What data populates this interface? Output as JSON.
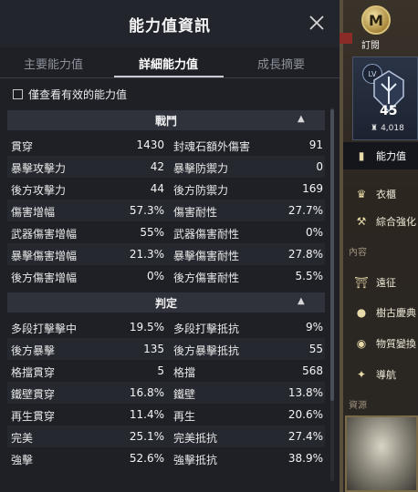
{
  "panel": {
    "title": "能力值資訊",
    "tabs": [
      {
        "label": "主要能力值",
        "active": false
      },
      {
        "label": "詳細能力值",
        "active": true
      },
      {
        "label": "成長摘要",
        "active": false
      }
    ],
    "filter_label": "僅查看有效的能力值",
    "sections": [
      {
        "title": "戰鬥",
        "rows": [
          {
            "left_label": "貫穿",
            "left_value": "1430",
            "right_label": "封魂石額外傷害",
            "right_value": "91"
          },
          {
            "left_label": "暴擊攻擊力",
            "left_value": "42",
            "right_label": "暴擊防禦力",
            "right_value": "0"
          },
          {
            "left_label": "後方攻擊力",
            "left_value": "44",
            "right_label": "後方防禦力",
            "right_value": "169"
          },
          {
            "left_label": "傷害增幅",
            "left_value": "57.3%",
            "right_label": "傷害耐性",
            "right_value": "27.7%"
          },
          {
            "left_label": "武器傷害增幅",
            "left_value": "55%",
            "right_label": "武器傷害耐性",
            "right_value": "0%"
          },
          {
            "left_label": "暴擊傷害增幅",
            "left_value": "21.3%",
            "right_label": "暴擊傷害耐性",
            "right_value": "27.8%"
          },
          {
            "left_label": "後方傷害增幅",
            "left_value": "0%",
            "right_label": "後方傷害耐性",
            "right_value": "5.5%"
          }
        ]
      },
      {
        "title": "判定",
        "rows": [
          {
            "left_label": "多段打擊擊中",
            "left_value": "19.5%",
            "right_label": "多段打擊抵抗",
            "right_value": "9%"
          },
          {
            "left_label": "後方暴擊",
            "left_value": "135",
            "right_label": "後方暴擊抵抗",
            "right_value": "55"
          },
          {
            "left_label": "格擋貫穿",
            "left_value": "5",
            "right_label": "格擋",
            "right_value": "568"
          },
          {
            "left_label": "鐵壁貫穿",
            "left_value": "16.8%",
            "right_label": "鐵壁",
            "right_value": "13.8%"
          },
          {
            "left_label": "再生貫穿",
            "left_value": "11.4%",
            "right_label": "再生",
            "right_value": "20.6%"
          },
          {
            "left_label": "完美",
            "left_value": "25.1%",
            "right_label": "完美抵抗",
            "right_value": "27.4%"
          },
          {
            "left_label": "強擊",
            "left_value": "52.6%",
            "right_label": "強擊抵抗",
            "right_value": "38.9%"
          }
        ]
      }
    ]
  },
  "menu": {
    "subscribe_badge": "M",
    "subscribe_label": "訂閱",
    "level_prefix": "LV",
    "level": "45",
    "gear_score": "4,018",
    "items": [
      {
        "label": "能力值",
        "icon": "bar-chart-icon",
        "active": true
      },
      {
        "label": "衣櫃",
        "icon": "wardrobe-icon",
        "active": false
      },
      {
        "label": "綜合強化",
        "icon": "anvil-icon",
        "active": false
      },
      {
        "label": "遠征",
        "icon": "gate-icon",
        "active": false
      },
      {
        "label": "樹古慶典",
        "icon": "hamster-icon",
        "active": false
      },
      {
        "label": "物質變換",
        "icon": "orb-icon",
        "active": false
      },
      {
        "label": "導航",
        "icon": "compass-icon",
        "active": false
      }
    ],
    "separators": [
      "內容",
      "資源"
    ]
  },
  "colors": {
    "accent": "#c9ccd4",
    "panel_bg": "#1e2026",
    "header_bg": "#2f323a",
    "menu_gold": "#d9c27a"
  }
}
